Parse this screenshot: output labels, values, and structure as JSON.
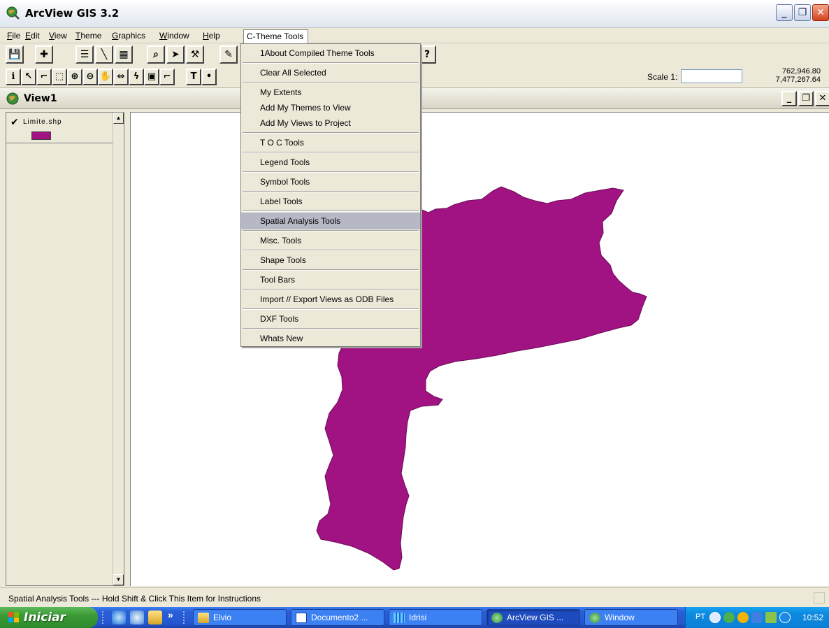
{
  "window": {
    "title": "ArcView GIS 3.2",
    "controls": {
      "minimize": "_",
      "maximize": "❐",
      "close": "✕"
    }
  },
  "menubar": {
    "items": [
      {
        "label": "File",
        "accel": "F",
        "rest": "ile"
      },
      {
        "label": "Edit",
        "accel": "E",
        "rest": "dit"
      },
      {
        "label": "View",
        "accel": "V",
        "rest": "iew"
      },
      {
        "label": "Theme",
        "accel": "T",
        "rest": "heme"
      },
      {
        "label": "Graphics",
        "accel": "G",
        "rest": "raphics"
      },
      {
        "label": "Window",
        "accel": "W",
        "rest": "indow"
      },
      {
        "label": "Help",
        "accel": "H",
        "rest": "elp"
      },
      {
        "label": "C-Theme Tools"
      }
    ]
  },
  "toolbar1": {
    "buttons": [
      "save",
      "add-theme",
      "theme-properties",
      "edit-legend",
      "open-table",
      "find",
      "locate-address",
      "query-builder",
      "edit-shape",
      "help-pointer"
    ],
    "glyphs": [
      "💾",
      "✚",
      "☰",
      "╲",
      "▦",
      "⌕",
      "➤",
      "⚒",
      "✎",
      "?"
    ]
  },
  "toolbar2": {
    "tools": [
      "identify",
      "pointer",
      "vertex-edit",
      "select-feature",
      "zoom-in",
      "zoom-out",
      "pan",
      "measure",
      "hotlink",
      "area-of-interest",
      "label",
      "text",
      "draw-point"
    ],
    "glyphs": [
      "ℹ",
      "↖",
      "⌐",
      "⬚",
      "⊕",
      "⊖",
      "✋",
      "⇔",
      "ϟ",
      "▣",
      "⌐",
      "T",
      "•"
    ],
    "scale_label": "Scale 1:",
    "scale_value": "",
    "coord_x": "762,946.80",
    "coord_y": "7,477,267.64"
  },
  "view": {
    "title": "View1",
    "controls": {
      "minimize": "_",
      "maximize": "❐",
      "close": "✕"
    }
  },
  "toc": {
    "layers": [
      {
        "name": "Limite.shp",
        "visible": true,
        "fill_color": "#a11283"
      }
    ],
    "scroll_up": "▲",
    "scroll_down": "▼"
  },
  "dropdown": {
    "items": [
      {
        "label": "1About Compiled Theme Tools"
      },
      {
        "label": "Clear All Selected"
      },
      {
        "label": "My Extents"
      },
      {
        "label": "Add My Themes to View"
      },
      {
        "label": "Add My Views to Project"
      },
      {
        "label": "T O C Tools"
      },
      {
        "label": "Legend Tools"
      },
      {
        "label": "Symbol Tools"
      },
      {
        "label": "Label Tools"
      },
      {
        "label": "Spatial Analysis Tools",
        "highlighted": true
      },
      {
        "label": "Misc. Tools"
      },
      {
        "label": "Shape Tools"
      },
      {
        "label": "Tool Bars"
      },
      {
        "label": "Import // Export Views as ODB Files"
      },
      {
        "label": "DXF Tools"
      },
      {
        "label": "Whats New"
      }
    ]
  },
  "statusbar": {
    "message": "Spatial Analysis Tools --- Hold Shift & Click This Item for Instructions"
  },
  "taskbar": {
    "start_label": "Iniciar",
    "chevron": "»",
    "tasks": [
      {
        "label": "Elvio",
        "icon": "folder-icon",
        "active": false
      },
      {
        "label": "Documento2 ...",
        "icon": "word-icon",
        "active": false
      },
      {
        "label": "Idrisi",
        "icon": "idrisi-icon",
        "active": false
      },
      {
        "label": "ArcView GIS ...",
        "icon": "arcview-icon",
        "active": true
      },
      {
        "label": "Window",
        "icon": "arcview-icon",
        "active": false
      }
    ],
    "tray_lang": "PT",
    "clock": "10:52"
  },
  "colors": {
    "polygon_fill": "#a11283",
    "menu_highlight": "#b6b8c6",
    "taskbar_blue": "#2456d0",
    "start_green": "#3a9a35"
  }
}
